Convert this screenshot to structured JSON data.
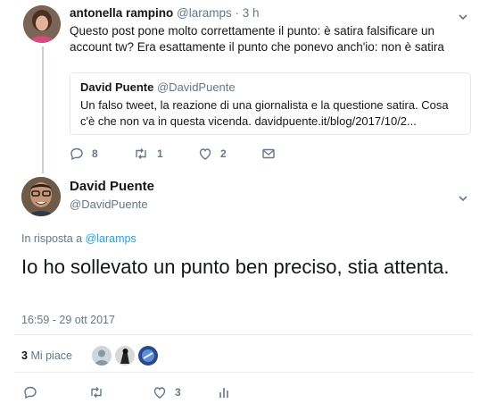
{
  "parent_tweet": {
    "author_name": "antonella rampino",
    "author_handle": "@laramps",
    "time_ago": "· 3 h",
    "text": "Questo post pone molto correttamente il punto: è satira falsificare un account tw? Era esattamente il punto che ponevo anch'io: non è satira",
    "quoted": {
      "author_name": "David Puente",
      "author_handle": "@DavidPuente",
      "text": "Un falso tweet, la reazione di una giornalista e la questione satira. Cosa c'è che non va in questa vicenda. davidpuente.it/blog/2017/10/2..."
    },
    "actions": {
      "replies": "8",
      "retweets": "1",
      "likes": "2"
    }
  },
  "main_tweet": {
    "author_name": "David Puente",
    "author_handle": "@DavidPuente",
    "reply_prefix": "In risposta a",
    "reply_handle": "@laramps",
    "text": "Io ho sollevato un punto ben preciso, stia attenta.",
    "timestamp": "16:59 - 29 ott 2017",
    "like_count": "3",
    "like_label": "Mi piace",
    "actions": {
      "likes": "3"
    }
  },
  "icons": [
    "reply-icon",
    "retweet-icon",
    "heart-icon",
    "mail-icon",
    "analytics-icon",
    "chevron-down-icon"
  ],
  "colors": {
    "accent": "#1da1f2",
    "secondary_text": "#657786",
    "border": "#e1e8ed",
    "thread_line": "#c4cfd6"
  }
}
